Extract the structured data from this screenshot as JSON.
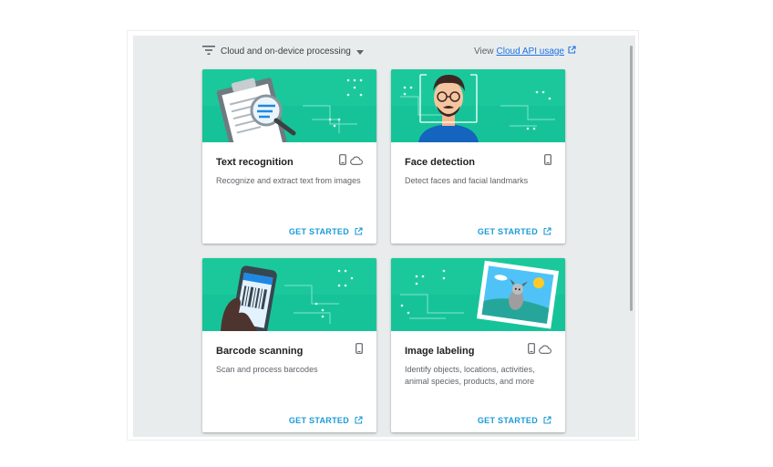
{
  "toolbar": {
    "filter_icon": "filter-icon",
    "filter_label": "Cloud and on-device processing",
    "dropdown_icon": "caret-down-icon",
    "view_prefix": "View",
    "api_link_label": "Cloud API usage",
    "external_icon": "external-link-icon"
  },
  "colors": {
    "banner": "#1bc89c",
    "link": "#1a73e8",
    "cta": "#1a9bd7",
    "panel_bg": "#e9ecec"
  },
  "cards": [
    {
      "title": "Text recognition",
      "description": "Recognize and extract text from images",
      "cta": "GET STARTED",
      "icons": [
        "phone-icon",
        "cloud-icon"
      ],
      "illustration": "clipboard-magnifier-illustration"
    },
    {
      "title": "Face detection",
      "description": "Detect faces and facial landmarks",
      "cta": "GET STARTED",
      "icons": [
        "phone-icon"
      ],
      "illustration": "face-illustration"
    },
    {
      "title": "Barcode scanning",
      "description": "Scan and process barcodes",
      "cta": "GET STARTED",
      "icons": [
        "phone-icon"
      ],
      "illustration": "phone-barcode-illustration"
    },
    {
      "title": "Image labeling",
      "description": "Identify objects, locations, activities, animal species, products, and more",
      "cta": "GET STARTED",
      "icons": [
        "phone-icon",
        "cloud-icon"
      ],
      "illustration": "photo-dog-illustration"
    }
  ]
}
